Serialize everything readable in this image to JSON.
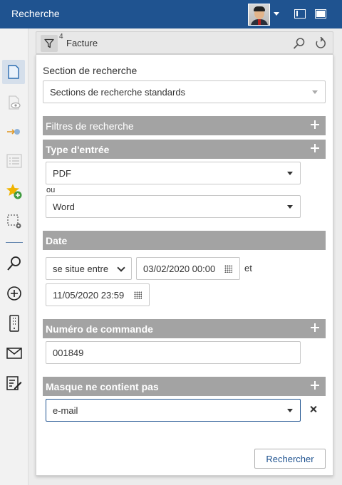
{
  "app": {
    "title": "Recherche"
  },
  "sidebar": {
    "items": [
      {
        "icon": "document-icon"
      },
      {
        "icon": "preview-icon"
      },
      {
        "icon": "pin-icon"
      },
      {
        "icon": "list-icon"
      },
      {
        "icon": "star-add-icon"
      },
      {
        "icon": "selection-settings-icon"
      },
      {
        "icon": "search-icon"
      },
      {
        "icon": "add-circle-icon"
      },
      {
        "icon": "mobile-icon"
      },
      {
        "icon": "mail-icon"
      },
      {
        "icon": "edit-list-icon"
      }
    ]
  },
  "search_bar": {
    "filter_count": "4",
    "query": "Facture"
  },
  "panel": {
    "section_label": "Section de recherche",
    "section_value": "Sections de recherche standards",
    "filters_header": "Filtres de recherche",
    "type_header": "Type d'entrée",
    "type_value_1": "PDF",
    "or_label": "ou",
    "type_value_2": "Word",
    "date_header": "Date",
    "date_operator": "se situe entre",
    "date_from": "03/02/2020 00:00",
    "and_label": "et",
    "date_to": "11/05/2020 23:59",
    "order_header": "Numéro de commande",
    "order_value": "001849",
    "mask_header": "Masque ne contient pas",
    "mask_value": "e-mail",
    "search_button": "Rechercher"
  },
  "colors": {
    "titlebar": "#1f5390",
    "section_header": "#a3a3a3",
    "accent": "#1f5390"
  }
}
